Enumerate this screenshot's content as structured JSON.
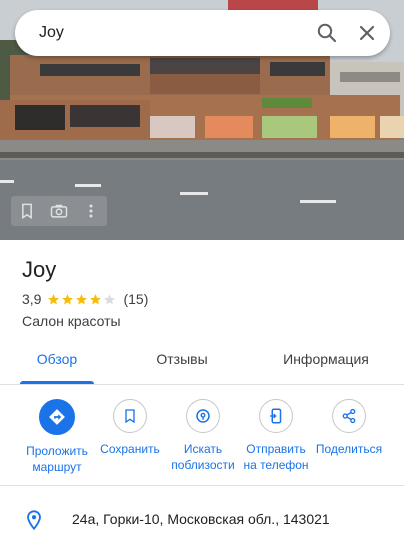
{
  "search": {
    "value": "Joy",
    "search_icon": "search-icon",
    "close_icon": "close-icon"
  },
  "photo": {
    "controls": [
      "bookmark-icon",
      "camera-icon",
      "more-vert-icon"
    ]
  },
  "place": {
    "name": "Joy",
    "rating": "3,9",
    "stars": 3.9,
    "review_count": "(15)",
    "category": "Салон красоты"
  },
  "tabs": [
    {
      "label": "Обзор",
      "active": true
    },
    {
      "label": "Отзывы",
      "active": false
    },
    {
      "label": "Информация",
      "active": false
    }
  ],
  "actions": [
    {
      "line1": "Проложить",
      "line2": "маршрут",
      "icon": "directions-icon"
    },
    {
      "line1": "Сохранить",
      "line2": "",
      "icon": "bookmark-icon"
    },
    {
      "line1": "Искать",
      "line2": "поблизости",
      "icon": "nearby-icon"
    },
    {
      "line1": "Отправить",
      "line2": "на телефон",
      "icon": "send-to-phone-icon"
    },
    {
      "line1": "Поделиться",
      "line2": "",
      "icon": "share-icon"
    }
  ],
  "address": {
    "icon": "location-pin-icon",
    "text": "24а, Горки-10, Московская обл., 143021"
  },
  "colors": {
    "accent": "#1a73e8",
    "star": "#fbbc04",
    "text": "#202124"
  }
}
